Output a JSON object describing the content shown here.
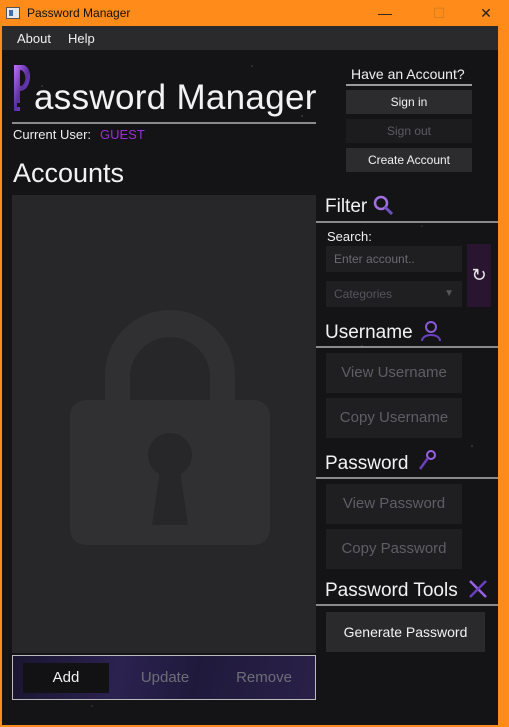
{
  "window": {
    "title": "Password Manager",
    "minimize_glyph": "—",
    "maximize_glyph": "☐",
    "close_glyph": "✕"
  },
  "menu": {
    "items": [
      {
        "label": "About"
      },
      {
        "label": "Help"
      }
    ]
  },
  "header": {
    "logo_letter": "P",
    "title_rest": "assword Manager",
    "current_user_label": "Current User:",
    "current_user_value": "GUEST"
  },
  "accounts": {
    "heading": "Accounts",
    "buttons": {
      "add": "Add",
      "update": "Update",
      "remove": "Remove"
    }
  },
  "auth": {
    "heading": "Have an Account?",
    "sign_in": "Sign in",
    "sign_out": "Sign out",
    "create_account": "Create Account"
  },
  "filter": {
    "heading": "Filter",
    "search_label": "Search:",
    "search_placeholder": "Enter account..",
    "category_placeholder": "Categories",
    "refresh_glyph": "↻"
  },
  "username": {
    "heading": "Username",
    "view": "View Username",
    "copy": "Copy Username"
  },
  "password": {
    "heading": "Password",
    "view": "View Password",
    "copy": "Copy Password"
  },
  "tools": {
    "heading": "Password Tools",
    "generate": "Generate Password"
  },
  "colors": {
    "title_bar": "#ff8c1a",
    "accent_purple": "#9b2dd6",
    "background": "#141416"
  }
}
